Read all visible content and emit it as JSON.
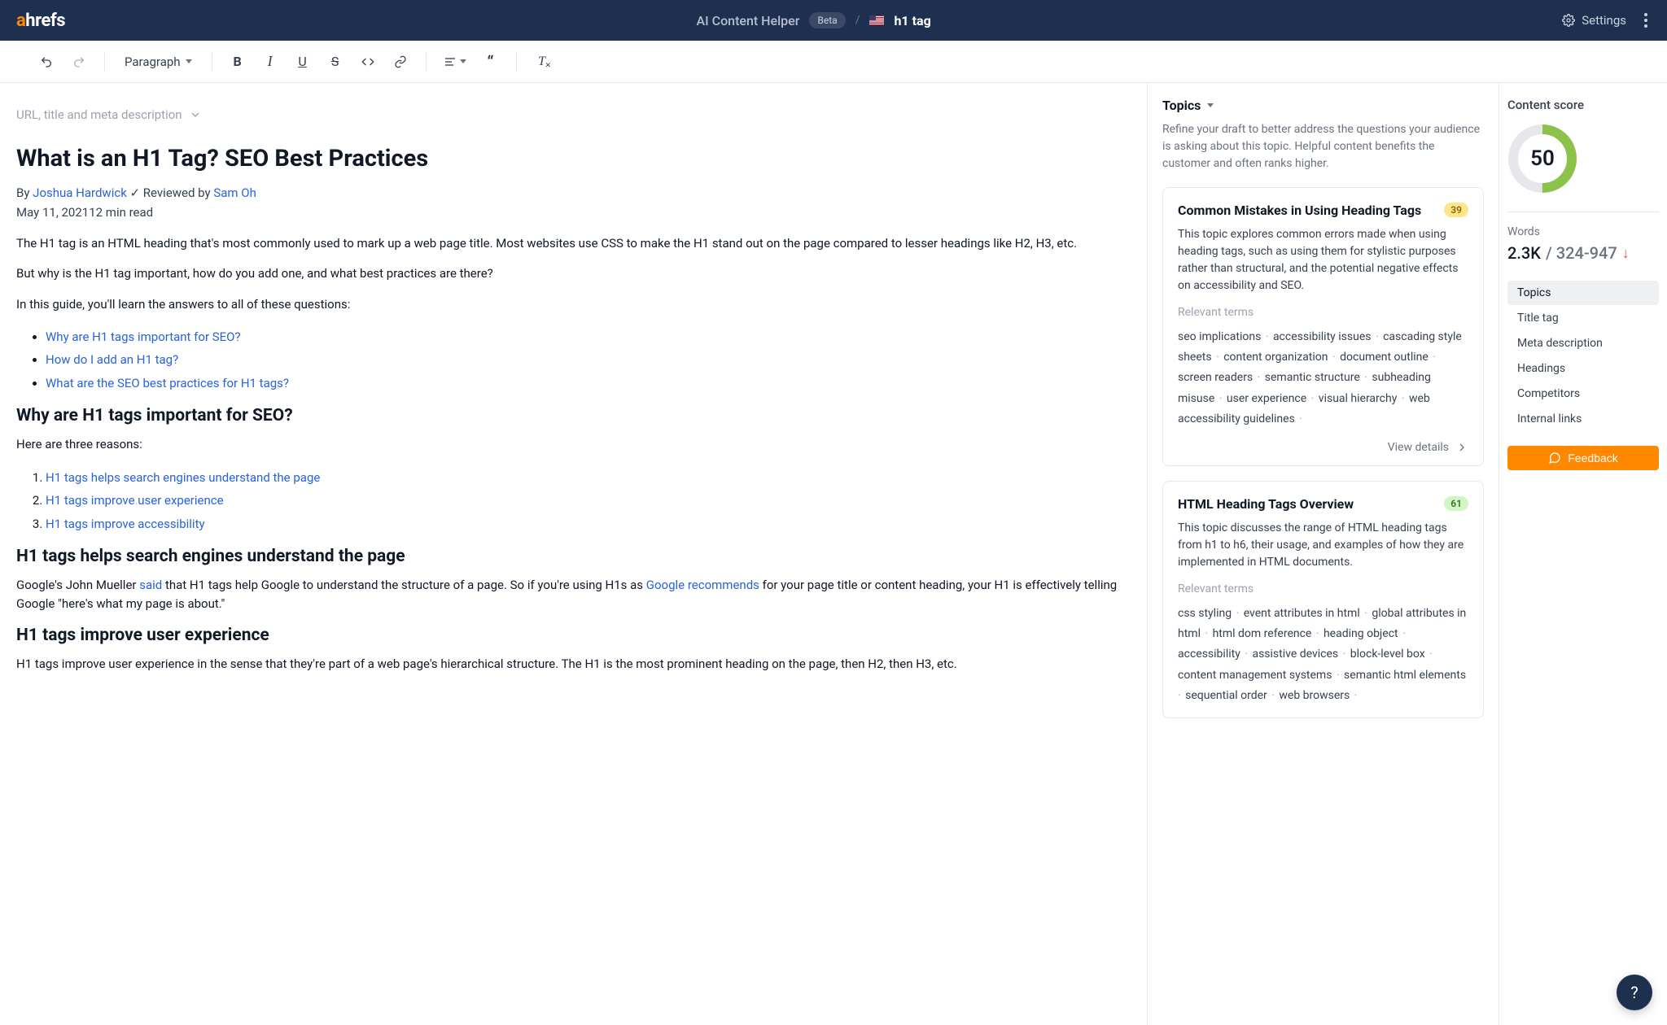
{
  "header": {
    "app_title": "AI Content Helper",
    "beta": "Beta",
    "keyword": "h1 tag",
    "settings": "Settings"
  },
  "toolbar": {
    "paragraph": "Paragraph"
  },
  "editor": {
    "meta_toggle": "URL, title and meta description",
    "title": "What is an H1 Tag? SEO Best Practices",
    "by": "By ",
    "author": "Joshua Hardwick",
    "reviewed_prefix": " ✓ Reviewed by ",
    "reviewer": "Sam Oh",
    "dateline": "May 11, 202112 min read",
    "p1": "The H1 tag is an HTML heading that's most commonly used to mark up a web page title. Most websites use CSS to make the H1 stand out on the page compared to lesser headings like H2, H3, etc.",
    "p2": "But why is the H1 tag important, how do you add one, and what best practices are there?",
    "p3": "In this guide, you'll learn the answers to all of these questions:",
    "toc": [
      "Why are H1 tags important for SEO?",
      "How do I add an H1 tag?",
      "What are the SEO best practices for H1 tags?"
    ],
    "h2a": "Why are H1 tags important for SEO?",
    "p4": "Here are three reasons:",
    "reasons": [
      "H1 tags helps search engines understand the page",
      "H1 tags improve user experience",
      "H1 tags improve accessibility"
    ],
    "h2b": "H1 tags helps search engines understand the page",
    "p5a": "Google's John Mueller ",
    "p5_said": "said",
    "p5b": " that H1 tags help Google to understand the structure of a page. So if you're using H1s as ",
    "p5_rec": "Google recommends",
    "p5c": " for your page title or content heading, your H1 is effectively telling Google \"here's what my page is about.\"",
    "h2c": "H1 tags improve user experience",
    "p6": "H1 tags improve user experience in the sense that they're part of a web page's hierarchical structure. The H1 is the most prominent heading on the page, then H2, then H3, etc."
  },
  "topics": {
    "label": "Topics",
    "desc": "Refine your draft to better address the questions your audience is asking about this topic. Helpful content benefits the customer and often ranks higher.",
    "relevant_label": "Relevant terms",
    "view_details": "View details",
    "cards": [
      {
        "title": "Common Mistakes in Using Heading Tags",
        "score": "39",
        "badge_class": "",
        "desc": "This topic explores common errors made when using heading tags, such as using them for stylistic purposes rather than structural, and the potential negative effects on accessibility and SEO.",
        "terms": [
          "seo implications",
          "accessibility issues",
          "cascading style sheets",
          "content organization",
          "document outline",
          "screen readers",
          "semantic structure",
          "subheading misuse",
          "user experience",
          "visual hierarchy",
          "web accessibility guidelines"
        ]
      },
      {
        "title": "HTML Heading Tags Overview",
        "score": "61",
        "badge_class": "green",
        "desc": "This topic discusses the range of HTML heading tags from h1 to h6, their usage, and examples of how they are implemented in HTML documents.",
        "terms": [
          "css styling",
          "event attributes in html",
          "global attributes in html",
          "html dom reference",
          "heading object",
          "accessibility",
          "assistive devices",
          "block-level box",
          "content management systems",
          "semantic html elements",
          "sequential order",
          "web browsers"
        ]
      }
    ]
  },
  "score": {
    "title": "Content score",
    "value": "50",
    "pct": 50,
    "words_label": "Words",
    "words_count": "2.3K",
    "words_sep": " / ",
    "words_range": "324-947",
    "nav": [
      "Topics",
      "Title tag",
      "Meta description",
      "Headings",
      "Competitors",
      "Internal links"
    ],
    "feedback": "Feedback"
  },
  "help": "?"
}
